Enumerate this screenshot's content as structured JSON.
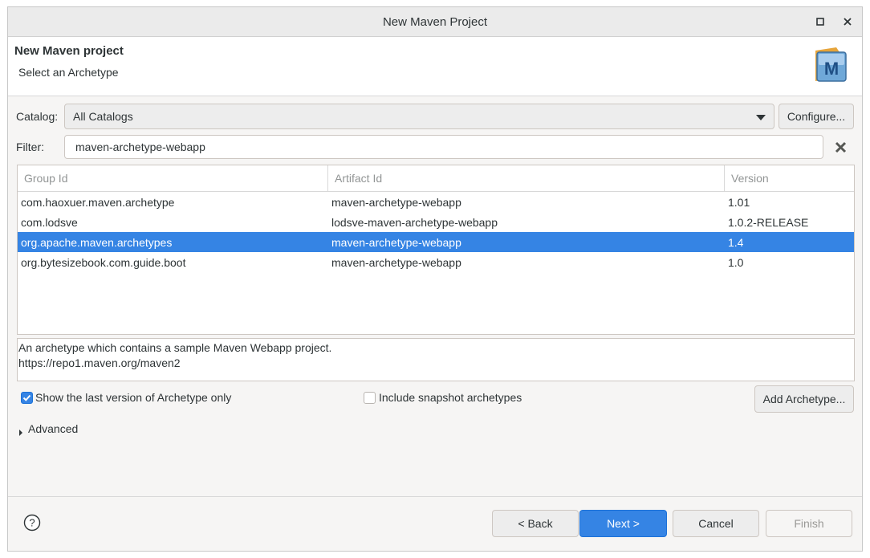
{
  "window": {
    "title": "New Maven Project"
  },
  "banner": {
    "title": "New Maven project",
    "subtitle": "Select an Archetype"
  },
  "catalog": {
    "label": "Catalog:",
    "value": "All Catalogs",
    "configure_label": "Configure..."
  },
  "filter": {
    "label": "Filter:",
    "value": "maven-archetype-webapp"
  },
  "table": {
    "headers": [
      "Group Id",
      "Artifact Id",
      "Version"
    ],
    "rows": [
      [
        "com.haoxuer.maven.archetype",
        "maven-archetype-webapp",
        "1.01"
      ],
      [
        "com.lodsve",
        "lodsve-maven-archetype-webapp",
        "1.0.2-RELEASE"
      ],
      [
        "org.apache.maven.archetypes",
        "maven-archetype-webapp",
        "1.4"
      ],
      [
        "org.bytesizebook.com.guide.boot",
        "maven-archetype-webapp",
        "1.0"
      ]
    ],
    "selected_index": 2
  },
  "description": {
    "line1": "An archetype which contains a sample Maven Webapp project.",
    "line2": "https://repo1.maven.org/maven2"
  },
  "options": {
    "show_last_version_label": "Show the last version of Archetype only",
    "show_last_version_checked": true,
    "include_snapshot_label": "Include snapshot archetypes",
    "include_snapshot_checked": false,
    "add_archetype_label": "Add Archetype..."
  },
  "advanced": {
    "label": "Advanced"
  },
  "buttons": {
    "back": "< Back",
    "next": "Next >",
    "cancel": "Cancel",
    "finish": "Finish"
  },
  "icons": {
    "maximize": "maximize-icon",
    "close": "close-icon",
    "maven": "maven-logo-icon",
    "clear": "clear-filter-icon",
    "help": "help-icon",
    "expand": "disclosure-triangle-icon"
  },
  "colors": {
    "accent": "#3584e4"
  }
}
